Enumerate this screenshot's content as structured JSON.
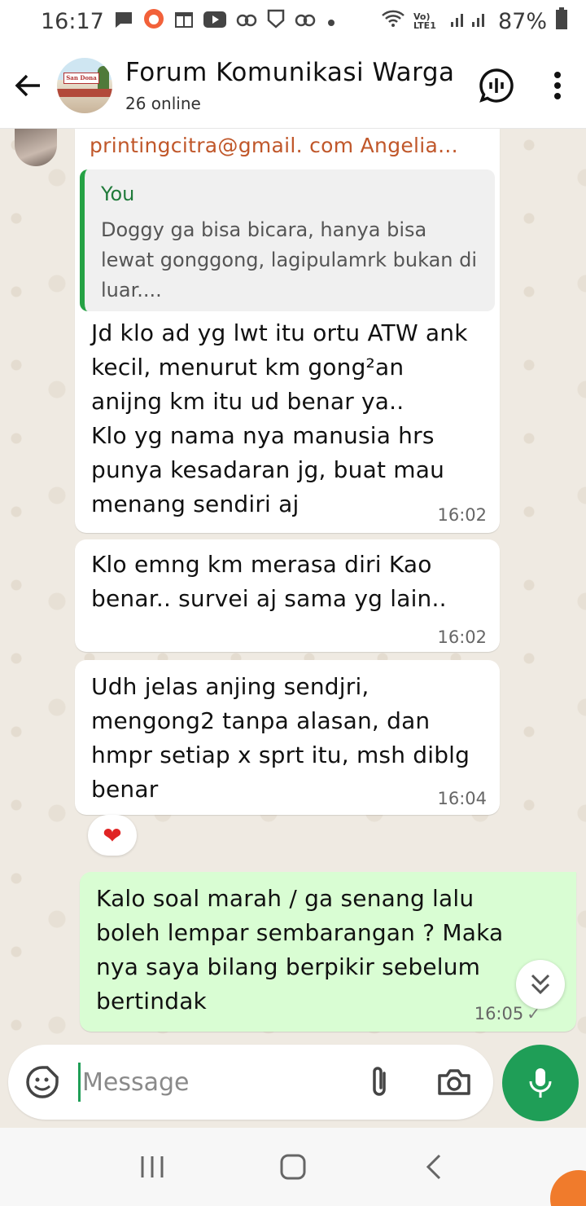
{
  "status_bar": {
    "time": "16:17",
    "lte_label": "Vo) LTE1",
    "battery": "87%"
  },
  "header": {
    "title": "Forum Komunikasi Warga",
    "subtitle": "26 online",
    "avatar_sign": "San Dona"
  },
  "messages": [
    {
      "sender": "printingcitra@gmail. com Angelia...",
      "quote_author": "You",
      "quote_text": "Doggy ga bisa bicara, hanya bisa lewat gonggong, lagipulamrk bukan di luar....",
      "lines": [
        "Jd klo ad yg lwt itu ortu ATW ank",
        "kecil, menurut km gong²an",
        "anijng km itu ud benar ya..",
        "Klo yg nama nya manusia hrs",
        "punya kesadaran jg, buat mau",
        "menang sendiri aj"
      ],
      "time": "16:02"
    },
    {
      "lines": [
        "Klo emng km merasa diri Kao",
        "benar.. survei aj sama yg lain.."
      ],
      "time": "16:02"
    },
    {
      "lines": [
        "Udh jelas anjing sendjri,",
        "mengong2 tanpa alasan,  dan",
        "hmpr setiap x sprt itu, msh diblg",
        "benar"
      ],
      "time": "16:04",
      "reaction": "❤"
    },
    {
      "lines": [
        "Kalo soal marah / ga senang lalu",
        "boleh lempar sembarangan ? Maka",
        "nya saya bilang berpikir sebelum",
        "bertindak"
      ],
      "time": "16:05"
    }
  ],
  "composer": {
    "placeholder": "Message"
  },
  "icons": {
    "back": "arrow-left-icon",
    "voice_chat": "voice-chat-icon",
    "menu": "more-vertical-icon",
    "emoji": "sticker-icon",
    "attach": "paperclip-icon",
    "camera": "camera-icon",
    "mic": "mic-icon",
    "scroll": "chevron-double-down-icon"
  },
  "colors": {
    "accent": "#1f9e57",
    "outgoing_bubble": "#d9fdd3",
    "sender_name": "#c0572a",
    "quote_bar": "#25a244",
    "reaction": "#e02424"
  }
}
